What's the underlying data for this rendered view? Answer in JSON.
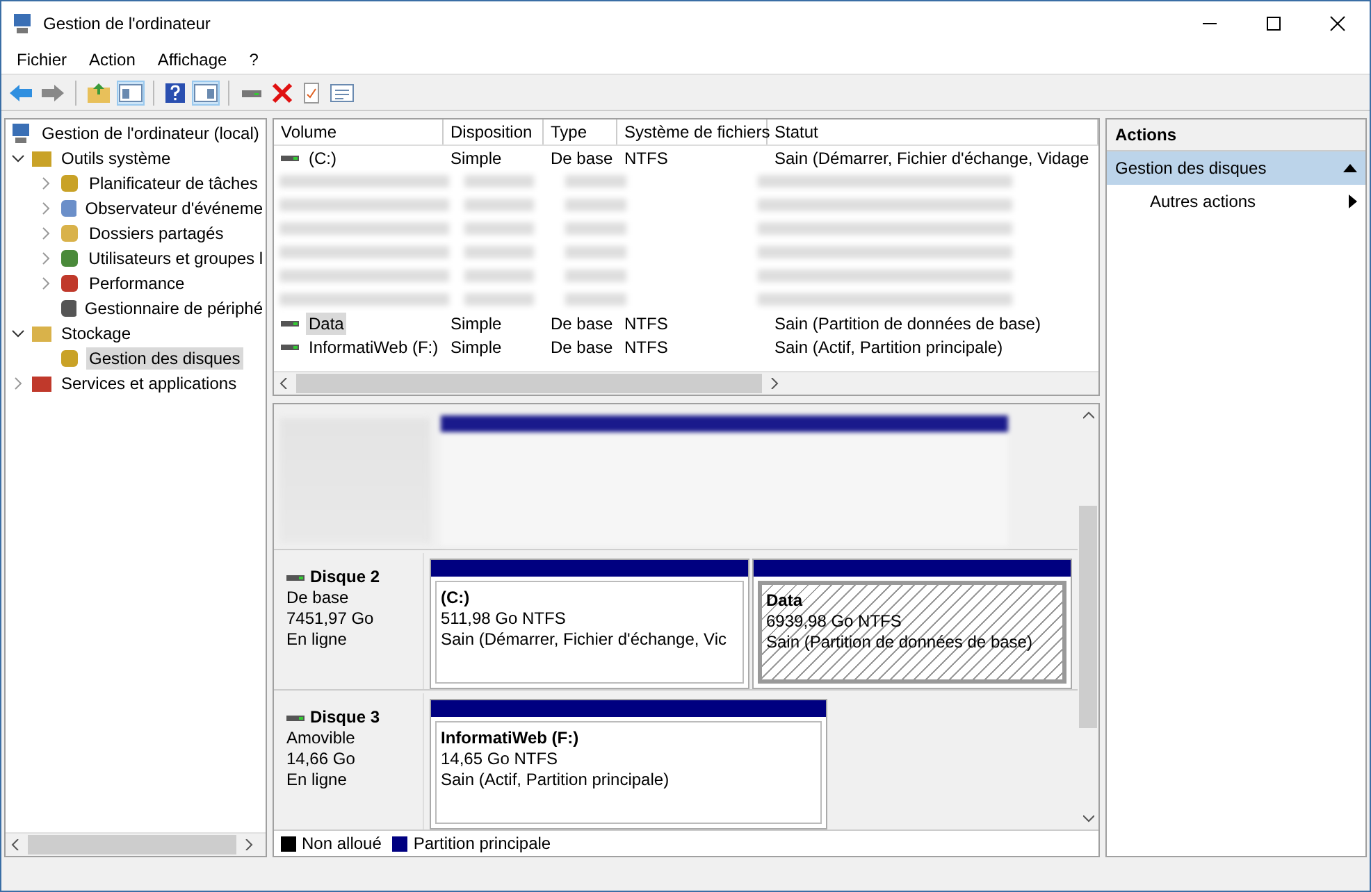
{
  "window": {
    "title": "Gestion de l'ordinateur"
  },
  "menu": [
    "Fichier",
    "Action",
    "Affichage",
    "?"
  ],
  "tree": {
    "label": "Gestion de l'ordinateur (local)",
    "children": [
      {
        "label": "Outils système",
        "expanded": true,
        "selected": false,
        "children": [
          {
            "label": "Planificateur de tâches",
            "expanded": false,
            "selected": false
          },
          {
            "label": "Observateur d'événeme",
            "expanded": false,
            "selected": false
          },
          {
            "label": "Dossiers partagés",
            "expanded": false,
            "selected": false
          },
          {
            "label": "Utilisateurs et groupes l",
            "expanded": false,
            "selected": false
          },
          {
            "label": "Performance",
            "expanded": false,
            "selected": false
          },
          {
            "label": "Gestionnaire de périphé",
            "selected": false
          }
        ]
      },
      {
        "label": "Stockage",
        "expanded": true,
        "selected": false,
        "children": [
          {
            "label": "Gestion des disques",
            "selected": true
          }
        ]
      },
      {
        "label": "Services et applications",
        "expanded": false,
        "selected": false
      }
    ]
  },
  "table": {
    "columns": [
      "Volume",
      "Disposition",
      "Type",
      "Système de fichiers",
      "Statut"
    ],
    "rows": [
      {
        "kind": "volume",
        "selected": false,
        "cells": [
          "(C:)",
          "Simple",
          "De base",
          "NTFS",
          "Sain (Démarrer, Fichier d'échange, Vidage"
        ]
      },
      {
        "kind": "blurred"
      },
      {
        "kind": "blurred"
      },
      {
        "kind": "blurred"
      },
      {
        "kind": "blurred"
      },
      {
        "kind": "blurred"
      },
      {
        "kind": "blurred"
      },
      {
        "kind": "volume",
        "selected": true,
        "cells": [
          "Data",
          "Simple",
          "De base",
          "NTFS",
          "Sain (Partition de données de base)"
        ]
      },
      {
        "kind": "volume",
        "selected": false,
        "cells": [
          "InformatiWeb (F:)",
          "Simple",
          "De base",
          "NTFS",
          "Sain (Actif, Partition principale)"
        ]
      }
    ]
  },
  "disks": [
    {
      "kind": "blurred"
    },
    {
      "kind": "disk",
      "name": "Disque 2",
      "type": "De base",
      "size": "7451,97 Go",
      "state": "En ligne",
      "partitions": [
        {
          "name": "(C:)",
          "size": "511,98 Go NTFS",
          "status": "Sain (Démarrer, Fichier d'échange, Vic",
          "selected": false
        },
        {
          "name": "Data",
          "size": "6939,98 Go NTFS",
          "status": "Sain (Partition de données de base)",
          "selected": true
        }
      ]
    },
    {
      "kind": "disk",
      "name": "Disque 3",
      "type": "Amovible",
      "size": "14,66 Go",
      "state": "En ligne",
      "partitions": [
        {
          "name": "InformatiWeb  (F:)",
          "size": "14,65 Go NTFS",
          "status": "Sain (Actif, Partition principale)",
          "selected": false
        }
      ]
    }
  ],
  "legend": [
    {
      "label": "Non alloué",
      "color": "#000000"
    },
    {
      "label": "Partition principale",
      "color": "#000080"
    }
  ],
  "actions": {
    "title": "Actions",
    "section": {
      "label": "Gestion des disques",
      "expanded": true
    },
    "items": [
      "Autres actions"
    ]
  }
}
